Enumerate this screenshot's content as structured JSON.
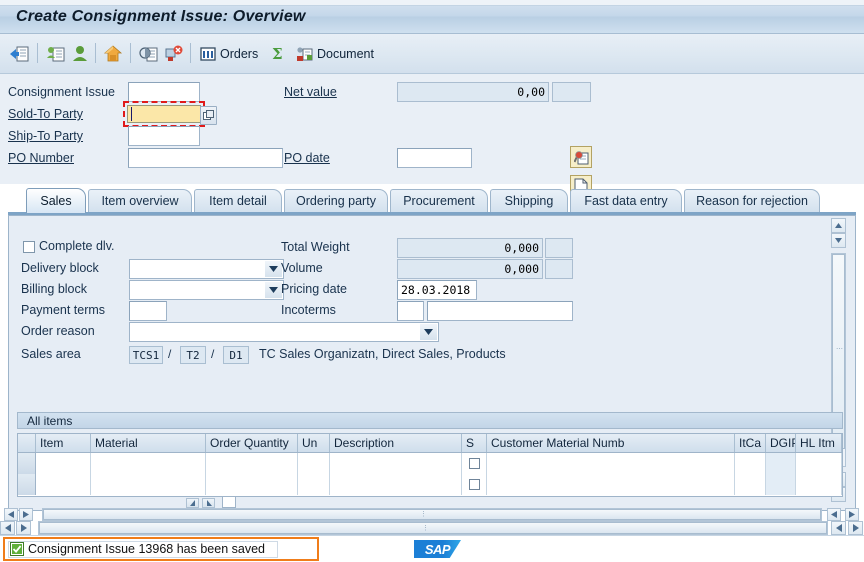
{
  "window": {
    "title": "Create Consignment Issue: Overview"
  },
  "toolbar": {
    "items": [
      {
        "name": "back-exit-icon",
        "label": ""
      },
      {
        "name": "display-document-icon",
        "label": ""
      },
      {
        "name": "partner-icon",
        "label": ""
      },
      {
        "name": "home-icon",
        "label": ""
      },
      {
        "name": "incompletion-log-icon",
        "label": ""
      },
      {
        "name": "reject-document-icon",
        "label": ""
      },
      {
        "name": "orders-icon",
        "label": "Orders"
      },
      {
        "name": "sum-icon",
        "label": ""
      },
      {
        "name": "document-icon",
        "label": "Document"
      }
    ],
    "orders_label": "Orders",
    "document_label": "Document"
  },
  "header": {
    "consignment_issue": {
      "label": "Consignment Issue",
      "value": "",
      "placeholder": ""
    },
    "sold_to_party": {
      "label": "Sold-To Party",
      "value": "",
      "placeholder": "",
      "focused": true
    },
    "ship_to_party": {
      "label": "Ship-To Party",
      "value": "",
      "placeholder": ""
    },
    "po_number": {
      "label": "PO Number",
      "value": "",
      "placeholder": ""
    },
    "net_value": {
      "label": "Net value",
      "value": "0,00",
      "currency": ""
    },
    "po_date": {
      "label": "PO date",
      "value": "",
      "placeholder": ""
    }
  },
  "tabs": [
    {
      "label": "Sales",
      "active": true
    },
    {
      "label": "Item overview",
      "active": false
    },
    {
      "label": "Item detail",
      "active": false
    },
    {
      "label": "Ordering party",
      "active": false
    },
    {
      "label": "Procurement",
      "active": false
    },
    {
      "label": "Shipping",
      "active": false
    },
    {
      "label": "Fast data entry",
      "active": false
    },
    {
      "label": "Reason for rejection",
      "active": false
    }
  ],
  "sales_tab": {
    "complete_dlv": {
      "label": "Complete dlv.",
      "checked": false
    },
    "delivery_block": {
      "label": "Delivery block",
      "value": ""
    },
    "billing_block": {
      "label": "Billing block",
      "value": ""
    },
    "payment_terms": {
      "label": "Payment terms",
      "value": ""
    },
    "order_reason": {
      "label": "Order reason",
      "value": ""
    },
    "total_weight": {
      "label": "Total Weight",
      "value": "0,000",
      "unit": ""
    },
    "volume": {
      "label": "Volume",
      "value": "0,000",
      "unit": ""
    },
    "pricing_date": {
      "label": "Pricing date",
      "value": "28.03.2018"
    },
    "incoterms": {
      "label": "Incoterms",
      "value": "",
      "value2": ""
    },
    "sales_area": {
      "label": "Sales area",
      "org": "TCS1",
      "channel": "T2",
      "division": "D1",
      "separator": "/",
      "description": "TC Sales Organizatn, Direct Sales, Products"
    }
  },
  "items_table": {
    "title": "All items",
    "columns": [
      "Item",
      "Material",
      "Order Quantity",
      "Un",
      "Description",
      "S",
      "Customer Material Numb",
      "ItCa",
      "DGIP",
      "HL Itm"
    ],
    "rows": [
      {
        "item": "",
        "material": "",
        "order_quantity": "",
        "un": "",
        "description": "",
        "s": false,
        "customer_material_numb": "",
        "itca": "",
        "dgip": "",
        "hl_itm": ""
      },
      {
        "item": "",
        "material": "",
        "order_quantity": "",
        "un": "",
        "description": "",
        "s": false,
        "customer_material_numb": "",
        "itca": "",
        "dgip": "",
        "hl_itm": ""
      }
    ]
  },
  "status": {
    "message": "Consignment Issue 13968 has been saved",
    "icon": "success-checkbox-icon",
    "logo": "SAP",
    "highlight_color": "#f07d1a"
  }
}
